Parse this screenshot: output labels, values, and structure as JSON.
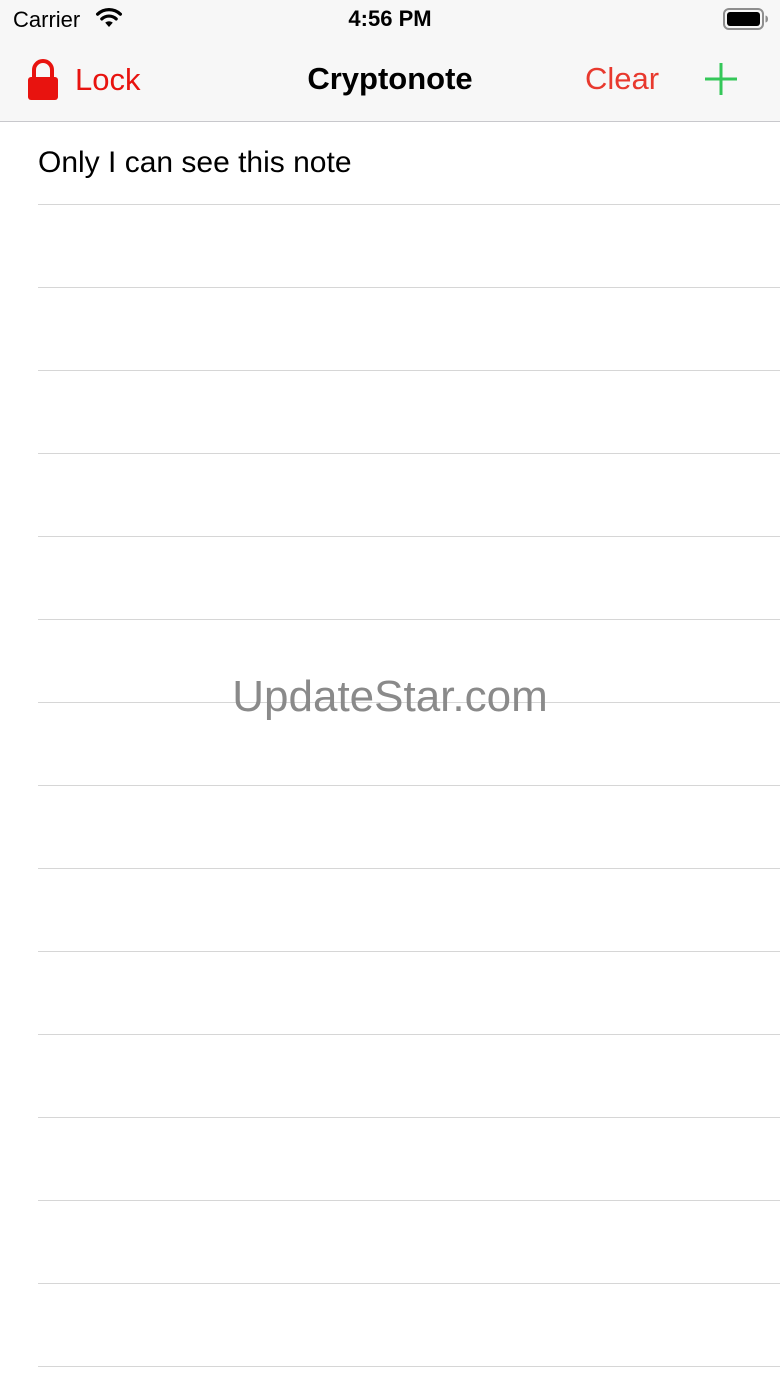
{
  "status_bar": {
    "carrier": "Carrier",
    "time": "4:56 PM",
    "wifi_icon": "wifi-icon",
    "battery_icon": "battery-icon"
  },
  "nav": {
    "lock_label": "Lock",
    "lock_icon": "lock-icon",
    "title": "Cryptonote",
    "clear_label": "Clear",
    "add_icon": "plus-icon",
    "colors": {
      "lock": "#e8130f",
      "clear": "#e8392e",
      "add": "#34c759"
    }
  },
  "notes": {
    "items": [
      "Only I can see this note"
    ]
  },
  "watermark": "UpdateStar.com"
}
